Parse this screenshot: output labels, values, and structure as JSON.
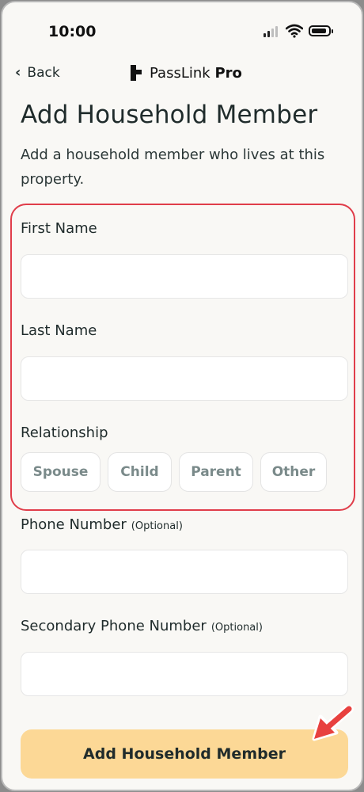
{
  "status_bar": {
    "time": "10:00"
  },
  "nav": {
    "back_label": "Back",
    "brand_name": "PassLink",
    "brand_suffix": "Pro"
  },
  "page": {
    "title": "Add Household Member",
    "subtitle": "Add a household member who lives at this property."
  },
  "form": {
    "first_name": {
      "label": "First Name",
      "value": "",
      "placeholder": ""
    },
    "last_name": {
      "label": "Last Name",
      "value": "",
      "placeholder": ""
    },
    "relationship": {
      "label": "Relationship",
      "options": [
        "Spouse",
        "Child",
        "Parent",
        "Other"
      ],
      "selected": null
    },
    "phone": {
      "label": "Phone Number",
      "optional_tag": "(Optional)",
      "value": "",
      "placeholder": ""
    },
    "secondary_phone": {
      "label": "Secondary Phone Number",
      "optional_tag": "(Optional)",
      "value": "",
      "placeholder": ""
    },
    "submit_label": "Add Household Member"
  },
  "colors": {
    "highlight_border": "#e03d4a",
    "submit_bg": "#fcd896",
    "arrow": "#e8413f",
    "chip_text": "#7a8a8a"
  }
}
